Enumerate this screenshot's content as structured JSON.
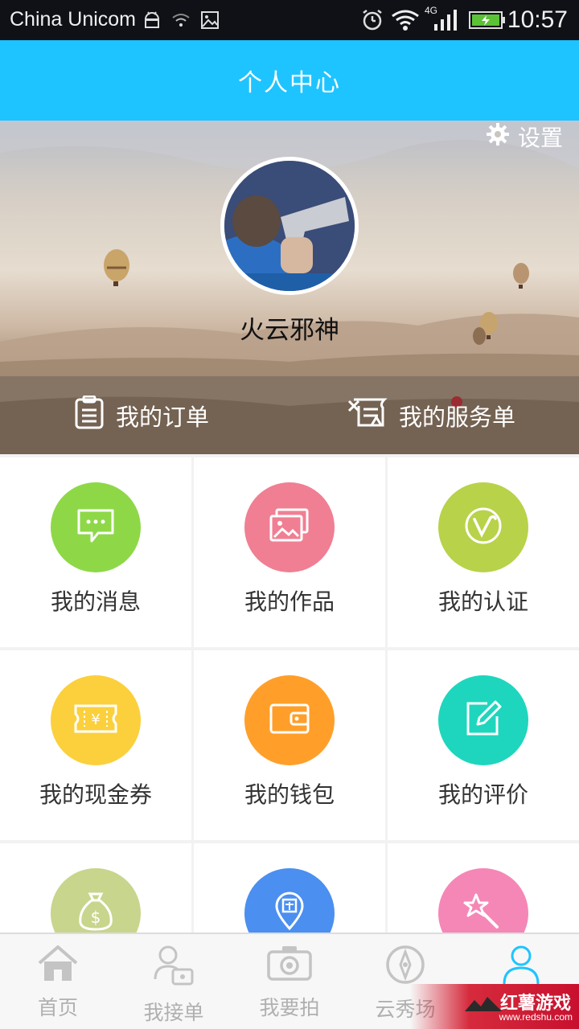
{
  "status_bar": {
    "carrier": "China Unicom",
    "network": "4G",
    "time": "10:57",
    "icons": [
      "android-icon",
      "wifi-weak-icon",
      "image-icon",
      "alarm-icon",
      "wifi-icon",
      "signal-icon",
      "battery-icon"
    ]
  },
  "header": {
    "title": "个人中心"
  },
  "profile": {
    "settings_label": "设置",
    "username": "火云邪神"
  },
  "orders": {
    "my_orders": "我的订单",
    "my_service_orders": "我的服务单"
  },
  "menu": [
    {
      "label": "我的消息",
      "icon": "message-icon",
      "color": "#8ed848"
    },
    {
      "label": "我的作品",
      "icon": "gallery-icon",
      "color": "#f07f93"
    },
    {
      "label": "我的认证",
      "icon": "verified-icon",
      "color": "#b8d24a"
    },
    {
      "label": "我的现金券",
      "icon": "coupon-icon",
      "color": "#fbd03c"
    },
    {
      "label": "我的钱包",
      "icon": "wallet-icon",
      "color": "#ff9f2a"
    },
    {
      "label": "我的评价",
      "icon": "edit-icon",
      "color": "#1ed6bd"
    },
    {
      "label": "",
      "icon": "money-bag-icon",
      "color": "#c8d58c"
    },
    {
      "label": "",
      "icon": "location-pin-icon",
      "color": "#4b8ff0"
    },
    {
      "label": "",
      "icon": "magic-wand-icon",
      "color": "#f587b6"
    }
  ],
  "bottom_nav": [
    {
      "label": "首页",
      "icon": "home-icon",
      "active": false
    },
    {
      "label": "我接单",
      "icon": "take-order-icon",
      "active": false
    },
    {
      "label": "我要拍",
      "icon": "camera-icon",
      "active": false
    },
    {
      "label": "云秀场",
      "icon": "compass-icon",
      "active": false
    },
    {
      "label": "",
      "icon": "profile-icon",
      "active": true
    }
  ],
  "watermark": {
    "title": "红薯游戏",
    "url": "www.redshu.com"
  },
  "colors": {
    "accent": "#1ec4ff",
    "active_nav": "#1ec4ff",
    "inactive_nav": "#b0b0b0"
  }
}
